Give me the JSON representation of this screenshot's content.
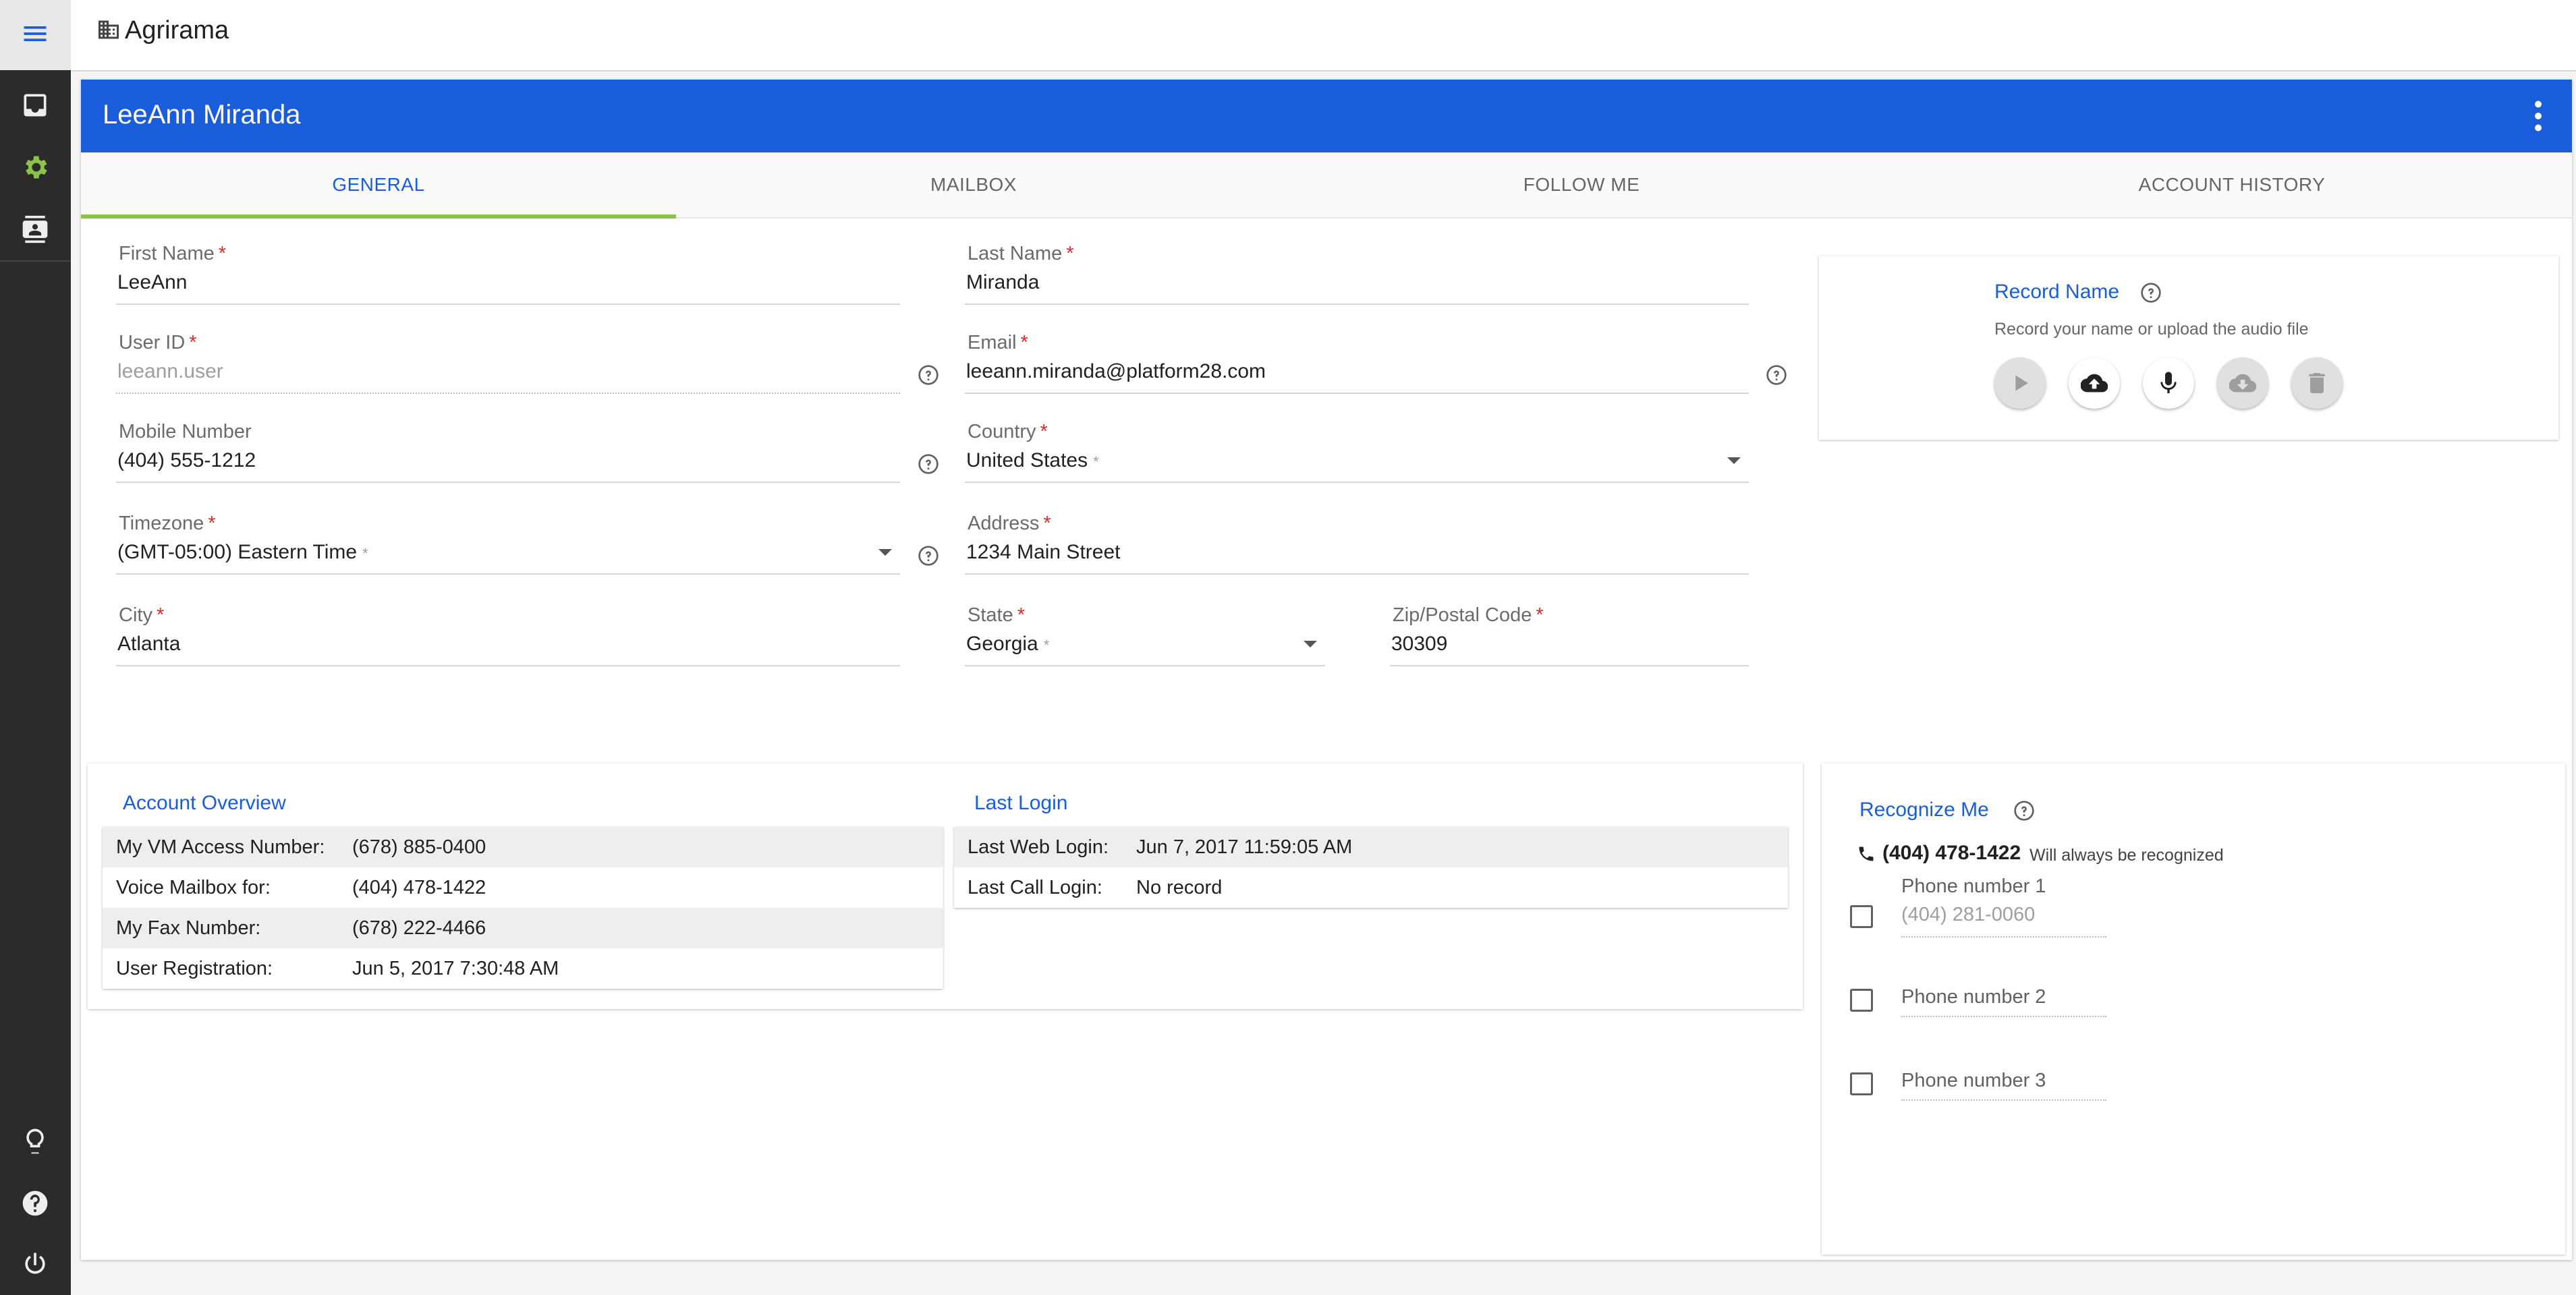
{
  "app": {
    "title": "Agrirama"
  },
  "rail": {
    "icons": [
      "menu-icon",
      "inbox-icon",
      "gear-icon",
      "contact-card-icon",
      "lightbulb-icon",
      "help-icon",
      "power-icon"
    ],
    "active_color": "#8bc34a"
  },
  "header": {
    "name": "LeeAnn Miranda",
    "color": "#1a5ddb"
  },
  "tabs": [
    {
      "label": "GENERAL",
      "active": true
    },
    {
      "label": "MAILBOX",
      "active": false
    },
    {
      "label": "FOLLOW ME",
      "active": false
    },
    {
      "label": "ACCOUNT HISTORY",
      "active": false
    }
  ],
  "form": {
    "first_name": {
      "label": "First Name",
      "value": "LeeAnn"
    },
    "last_name": {
      "label": "Last Name",
      "value": "Miranda"
    },
    "user_id": {
      "label": "User ID",
      "value": "leeann.user"
    },
    "email": {
      "label": "Email",
      "value": "leeann.miranda@platform28.com"
    },
    "mobile": {
      "label": "Mobile Number",
      "value": "(404) 555-1212"
    },
    "country": {
      "label": "Country",
      "value": "United States"
    },
    "timezone": {
      "label": "Timezone",
      "value": "(GMT-05:00) Eastern Time"
    },
    "address": {
      "label": "Address",
      "value": "1234 Main Street"
    },
    "city": {
      "label": "City",
      "value": "Atlanta"
    },
    "state": {
      "label": "State",
      "value": "Georgia"
    },
    "zip": {
      "label": "Zip/Postal Code",
      "value": "30309"
    },
    "required_mark": "*"
  },
  "record_name": {
    "title": "Record Name",
    "subtitle": "Record your name or upload the audio file",
    "buttons": [
      "play-icon",
      "cloud-upload-icon",
      "microphone-icon",
      "cloud-download-icon",
      "trash-icon"
    ]
  },
  "account_overview": {
    "title": "Account Overview",
    "rows": [
      {
        "label": "My VM Access Number:",
        "value": "(678) 885-0400"
      },
      {
        "label": "Voice Mailbox for:",
        "value": "(404) 478-1422"
      },
      {
        "label": "My Fax Number:",
        "value": "(678) 222-4466"
      },
      {
        "label": "User Registration:",
        "value": "Jun 5, 2017 7:30:48 AM"
      }
    ]
  },
  "last_login": {
    "title": "Last Login",
    "rows": [
      {
        "label": "Last Web Login:",
        "value": "Jun 7, 2017 11:59:05 AM"
      },
      {
        "label": "Last Call Login:",
        "value": "No record"
      }
    ]
  },
  "recognize_me": {
    "title": "Recognize Me",
    "primary_number": "(404) 478-1422",
    "primary_note": "Will always be recognized",
    "phones": [
      {
        "label": "Phone number 1",
        "value": "(404) 281-0060",
        "checked": false
      },
      {
        "label": "Phone number 2",
        "value": "",
        "checked": false
      },
      {
        "label": "Phone number 3",
        "value": "",
        "checked": false
      }
    ]
  }
}
